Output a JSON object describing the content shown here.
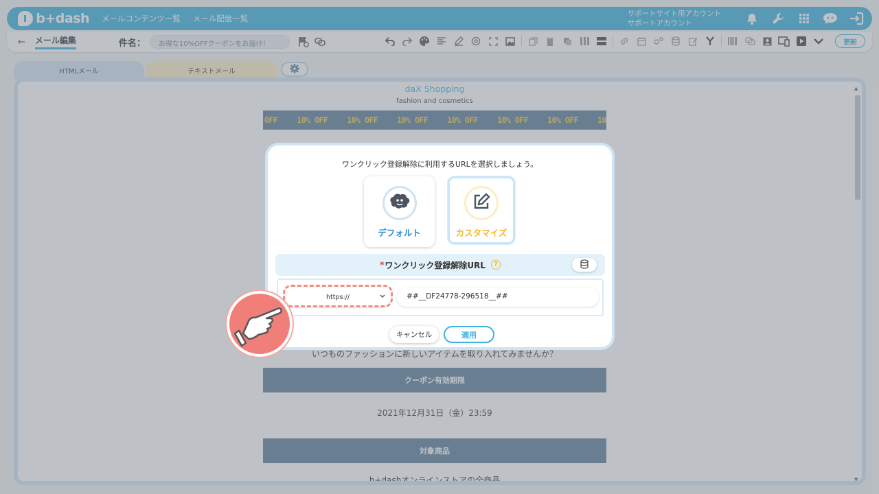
{
  "app": {
    "logo_text": "b+dash",
    "nav_links": [
      "メールコンテンツ一覧",
      "メール配信一覧"
    ],
    "support_account_line1": "サポートサイト用アカウント",
    "support_account_line2": "サポートアカウント"
  },
  "toolbar": {
    "back_arrow": "←",
    "page_title": "メール編集",
    "subject_label": "件名：",
    "subject_value": "お得な10%OFFクーポンをお届け！",
    "update_label": "更新"
  },
  "tabs": {
    "html_label": "HTMLメール",
    "text_label": "テキストメール"
  },
  "email": {
    "brand": "daX Shopping",
    "tagline": "fashion and cosmetics",
    "banner_items": [
      "OFF",
      "10% OFF",
      "10% OFF",
      "10% OFF",
      "10% OFF",
      "10% OFF",
      "10% OFF",
      "10% OFF"
    ],
    "body_line": "いつものファッションに新しいアイテムを取り入れてみませんか？",
    "coupon_header": "クーポン有効期限",
    "expiry": "2021年12月31日（金）23:59",
    "target_header": "対象商品",
    "target_line": "b+dashオンラインストアの全商品"
  },
  "modal": {
    "instruction": "ワンクリック登録解除に利用するURLを選択しましょう。",
    "mode_default_label": "デフォルト",
    "mode_custom_label": "カスタマイズ",
    "selected_mode": "カスタマイズ",
    "url_required_mark": "*",
    "url_header": "ワンクリック登録解除URL",
    "help_glyph": "?",
    "protocol_value": "https://",
    "url_value": "##__DF24778-296518__##",
    "cancel_label": "キャンセル",
    "apply_label": "適用"
  },
  "colors": {
    "brand_blue": "#3db3e0",
    "accent_yellow": "#f5b927",
    "banner_bg": "#5f7e9c",
    "highlight_red": "#f28b82"
  },
  "icons": {
    "toolbar": [
      "undo-icon",
      "redo-icon",
      "palette-icon",
      "align-icon",
      "pen-icon",
      "target-icon",
      "expand-icon",
      "image-icon",
      "copy-icon",
      "trash-icon",
      "duplicate-icon",
      "columns-icon",
      "rows-icon",
      "link-icon",
      "calendar-icon",
      "gears-icon",
      "database-icon",
      "edit-icon",
      "branch-icon",
      "barcode-icon",
      "coupon-icon",
      "contact-icon",
      "device-icon",
      "play-icon",
      "chevron-down-icon"
    ]
  }
}
